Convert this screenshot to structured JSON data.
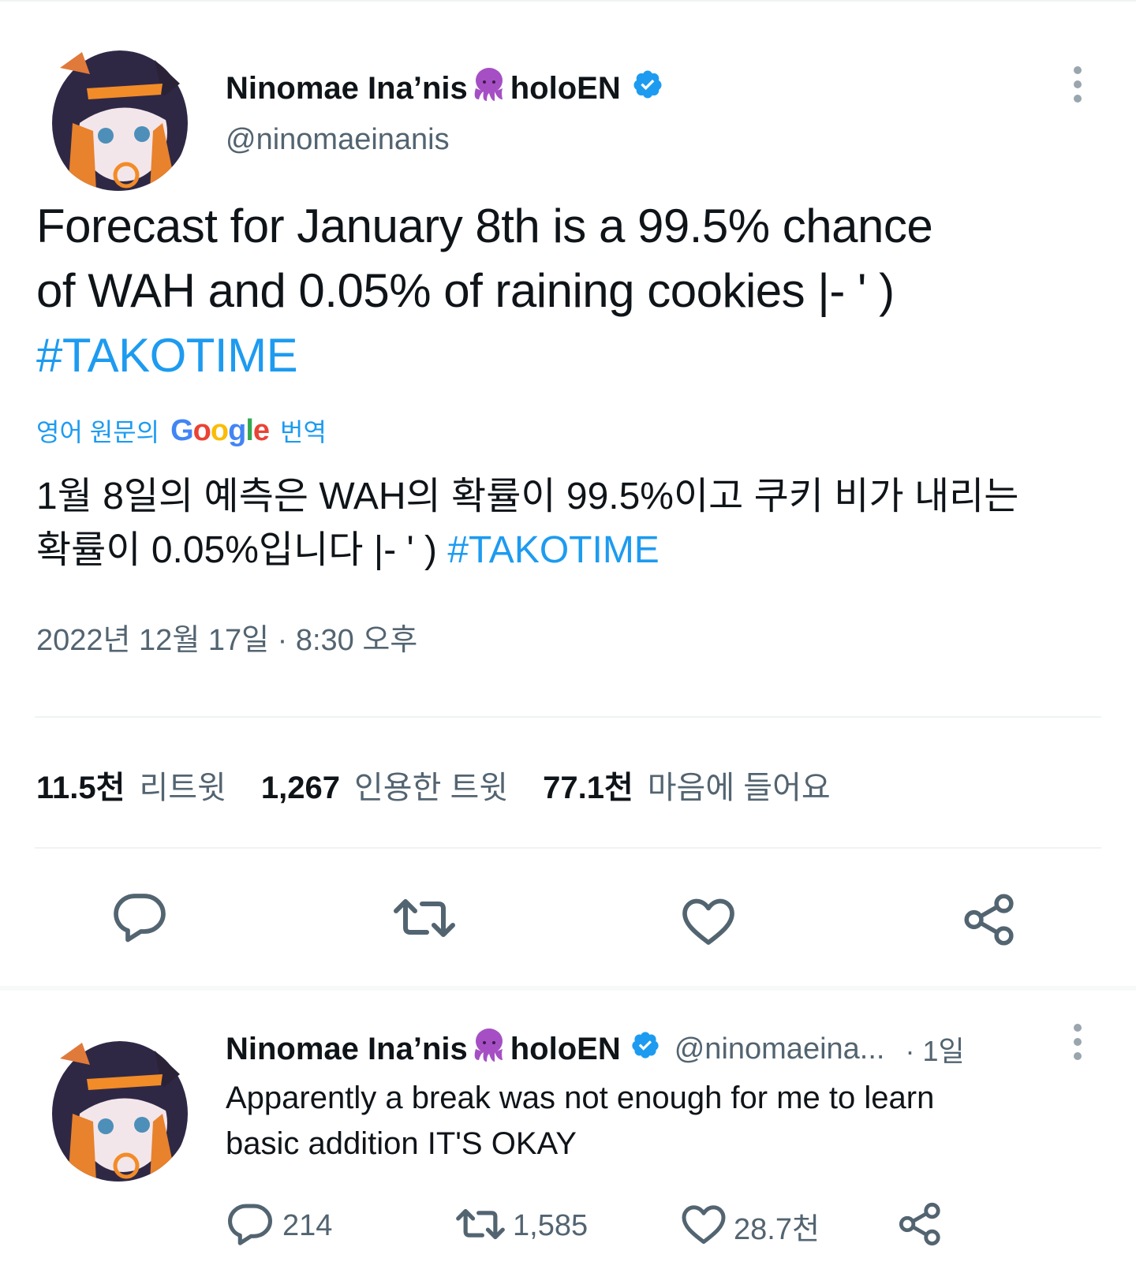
{
  "tweet": {
    "author_name_part1": "Ninomae Ina’nis",
    "author_name_part2": "holoEN",
    "author_handle": "@ninomaeinanis",
    "text_line1": "Forecast for January 8th is a 99.5% chance",
    "text_line2": "of WAH and 0.05% of raining cookies |- ' )",
    "hashtag": "#TAKOTIME",
    "translate": {
      "prefix": "영어 원문의",
      "google_letters": [
        "G",
        "o",
        "o",
        "g",
        "l",
        "e"
      ],
      "suffix": "번역"
    },
    "translated_line1": "1월 8일의 예측은 WAH의 확률이 99.5%이고 쿠키 비가 내리는",
    "translated_line2": "확률이 0.05%입니다 |- ' ) ",
    "translated_hashtag": "#TAKOTIME",
    "timestamp": "2022년 12월 17일 · 8:30 오후",
    "stats": [
      {
        "num": "11.5천",
        "label": "리트윗"
      },
      {
        "num": "1,267",
        "label": "인용한 트윗"
      },
      {
        "num": "77.1천",
        "label": "마음에 들어요"
      }
    ],
    "icons": [
      "reply-icon",
      "retweet-icon",
      "like-icon",
      "share-icon"
    ]
  },
  "reply": {
    "author_name_part1": "Ninomae Ina’nis",
    "author_name_part2": "holoEN",
    "author_handle": "@ninomaeina...",
    "time": "· 1일",
    "text_line1": "Apparently a break was not enough for me to learn",
    "text_line2": "basic addition IT'S OKAY",
    "reply_count": "214",
    "retweet_count": "1,585",
    "like_count": "28.7천"
  },
  "colors": {
    "accent": "#1d9bf0",
    "text": "#0f1419",
    "secondary": "#536471",
    "octopus": "#a64fc4"
  }
}
